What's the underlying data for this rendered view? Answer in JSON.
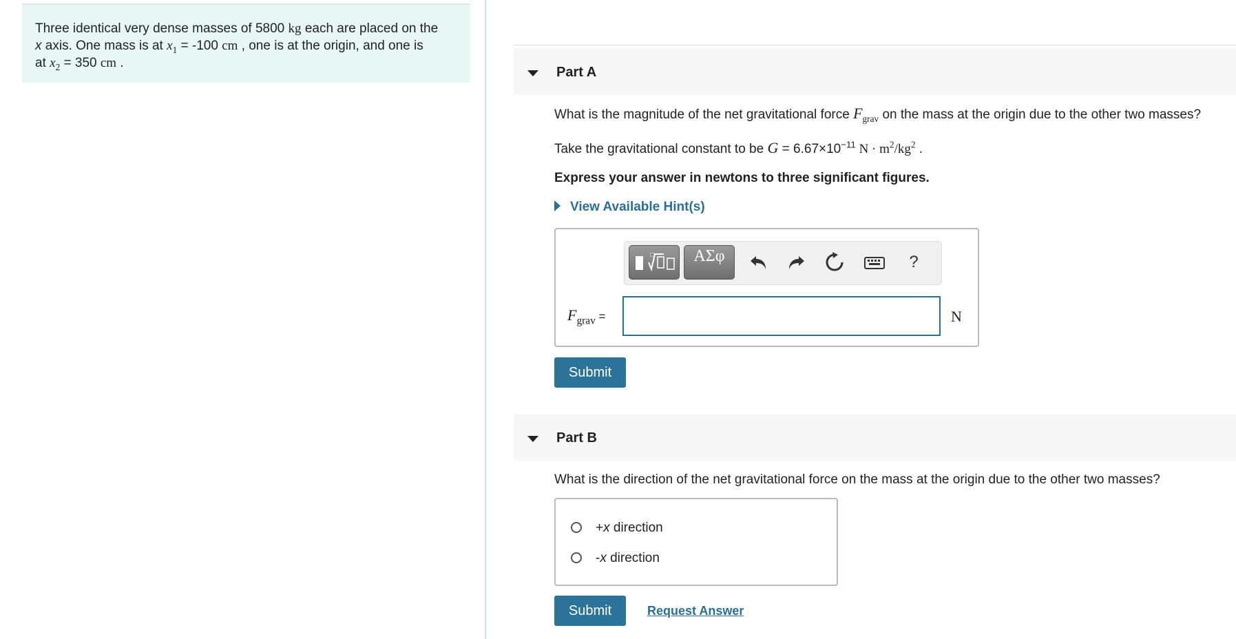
{
  "problem": {
    "p1": "Three identical very dense masses of 5800",
    "u_kg": "kg",
    "p2": " each are placed on the",
    "p3": "x",
    "p4": " axis. One mass is at ",
    "x1_var": "x",
    "x1_sub": "1",
    "p5": " = -100 ",
    "u_cm1": "cm",
    "p6": " , one is at the origin, and one is",
    "p7": "at ",
    "x2_var": "x",
    "x2_sub": "2",
    "p8": " = 350 ",
    "u_cm2": "cm",
    "p9": " ."
  },
  "partA": {
    "title": "Part A",
    "q1a": "What is the magnitude of the net gravitational force ",
    "F": "F",
    "Fsub": "grav",
    "q1b": " on the mass at the origin due to the other two masses?",
    "q2a": "Take the gravitational constant to be ",
    "G": "G",
    "q2b": " = 6.67×10",
    "q2exp": "−11",
    "q2N": " N · m",
    "q2sq": "2",
    "q2kg": "/kg",
    "q2sq2": "2",
    "q2end": " .",
    "instruction": "Express your answer in newtons to three significant figures.",
    "hint": "View Available Hint(s)",
    "toolbar_greek": "ΑΣφ",
    "help": "?",
    "field_var": "F",
    "field_sub": "grav",
    "equals": " =",
    "input_value": "",
    "unit": "N",
    "submit": "Submit"
  },
  "partB": {
    "title": "Part B",
    "question": "What is the direction of the net gravitational force on the mass at the origin due to the other two masses?",
    "options": [
      {
        "sign": "+",
        "var": "x",
        "text": " direction"
      },
      {
        "sign": "-",
        "var": "x",
        "text": " direction"
      }
    ],
    "submit": "Submit",
    "request": "Request Answer"
  }
}
